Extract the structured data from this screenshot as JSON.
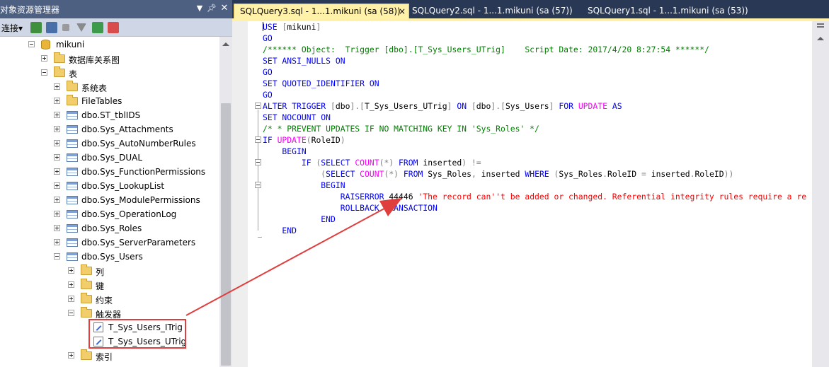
{
  "object_explorer": {
    "title": "对象资源管理器",
    "pin_icon": "pin-icon",
    "close_icon": "close-icon",
    "toolbar": {
      "connect_label": "连接",
      "connect_caret": "▾"
    },
    "tree": [
      {
        "label": "mikuni",
        "icon": "database-icon",
        "expander": "minus"
      },
      {
        "label": "数据库关系图",
        "icon": "folder-icon",
        "expander": "plus"
      },
      {
        "label": "表",
        "icon": "folder-icon",
        "expander": "minus"
      },
      {
        "label": "系统表",
        "icon": "folder-icon",
        "expander": "plus"
      },
      {
        "label": "FileTables",
        "icon": "folder-icon",
        "expander": "plus"
      },
      {
        "label": "dbo.ST_tblIDS",
        "icon": "table-icon",
        "expander": "plus"
      },
      {
        "label": "dbo.Sys_Attachments",
        "icon": "table-icon",
        "expander": "plus"
      },
      {
        "label": "dbo.Sys_AutoNumberRules",
        "icon": "table-icon",
        "expander": "plus"
      },
      {
        "label": "dbo.Sys_DUAL",
        "icon": "table-icon",
        "expander": "plus"
      },
      {
        "label": "dbo.Sys_FunctionPermissions",
        "icon": "table-icon",
        "expander": "plus"
      },
      {
        "label": "dbo.Sys_LookupList",
        "icon": "table-icon",
        "expander": "plus"
      },
      {
        "label": "dbo.Sys_ModulePermissions",
        "icon": "table-icon",
        "expander": "plus"
      },
      {
        "label": "dbo.Sys_OperationLog",
        "icon": "table-icon",
        "expander": "plus"
      },
      {
        "label": "dbo.Sys_Roles",
        "icon": "table-icon",
        "expander": "plus"
      },
      {
        "label": "dbo.Sys_ServerParameters",
        "icon": "table-icon",
        "expander": "plus"
      },
      {
        "label": "dbo.Sys_Users",
        "icon": "table-icon",
        "expander": "minus"
      },
      {
        "label": "列",
        "icon": "folder-icon",
        "expander": "plus"
      },
      {
        "label": "键",
        "icon": "folder-icon",
        "expander": "plus"
      },
      {
        "label": "约束",
        "icon": "folder-icon",
        "expander": "plus"
      },
      {
        "label": "触发器",
        "icon": "folder-icon",
        "expander": "minus"
      },
      {
        "label": "T_Sys_Users_ITrig",
        "icon": "trigger-icon",
        "expander": "none"
      },
      {
        "label": "T_Sys_Users_UTrig",
        "icon": "trigger-icon",
        "expander": "none"
      },
      {
        "label": "索引",
        "icon": "folder-icon",
        "expander": "plus"
      }
    ]
  },
  "tabs": [
    {
      "label": "SQLQuery3.sql - 1...1.mikuni (sa (58))",
      "active": true,
      "close": "×"
    },
    {
      "label": "SQLQuery2.sql - 1...1.mikuni (sa (57))",
      "active": false
    },
    {
      "label": "SQLQuery1.sql - 1...1.mikuni (sa (53))",
      "active": false
    }
  ],
  "code_lines": [
    [
      [
        "kw",
        "USE "
      ],
      [
        "gr",
        "["
      ],
      [
        "tx",
        "mikuni"
      ],
      [
        "gr",
        "]"
      ]
    ],
    [
      [
        "kw",
        "GO"
      ]
    ],
    [
      [
        "cm",
        "/****** Object:  Trigger [dbo].[T_Sys_Users_UTrig]    Script Date: 2017/4/20 8:27:54 ******/"
      ]
    ],
    [
      [
        "kw",
        "SET ANSI_NULLS ON"
      ]
    ],
    [
      [
        "kw",
        "GO"
      ]
    ],
    [
      [
        "kw",
        "SET QUOTED_IDENTIFIER ON"
      ]
    ],
    [
      [
        "kw",
        "GO"
      ]
    ],
    [
      [
        "kw",
        "ALTER TRIGGER "
      ],
      [
        "gr",
        "["
      ],
      [
        "tx",
        "dbo"
      ],
      [
        "gr",
        "].["
      ],
      [
        "tx",
        "T_Sys_Users_UTrig"
      ],
      [
        "gr",
        "]"
      ],
      [
        "kw",
        " ON "
      ],
      [
        "gr",
        "["
      ],
      [
        "tx",
        "dbo"
      ],
      [
        "gr",
        "].["
      ],
      [
        "tx",
        "Sys_Users"
      ],
      [
        "gr",
        "]"
      ],
      [
        "kw",
        " FOR "
      ],
      [
        "fn",
        "UPDATE"
      ],
      [
        "kw",
        " AS"
      ]
    ],
    [
      [
        "kw",
        "SET NOCOUNT ON"
      ]
    ],
    [
      [
        "cm",
        "/* * PREVENT UPDATES IF NO MATCHING KEY IN 'Sys_Roles' */"
      ]
    ],
    [
      [
        "kw",
        "IF "
      ],
      [
        "fn",
        "UPDATE"
      ],
      [
        "gr",
        "("
      ],
      [
        "tx",
        "RoleID"
      ],
      [
        "gr",
        ")"
      ]
    ],
    [
      [
        "kw",
        "    BEGIN"
      ]
    ],
    [
      [
        "kw",
        "        IF "
      ],
      [
        "gr",
        "("
      ],
      [
        "kw",
        "SELECT "
      ],
      [
        "fn",
        "COUNT"
      ],
      [
        "gr",
        "(*)"
      ],
      [
        "kw",
        " FROM "
      ],
      [
        "tx",
        "inserted"
      ],
      [
        "gr",
        ") !="
      ]
    ],
    [
      [
        "tx",
        "            "
      ],
      [
        "gr",
        "("
      ],
      [
        "kw",
        "SELECT "
      ],
      [
        "fn",
        "COUNT"
      ],
      [
        "gr",
        "(*)"
      ],
      [
        "kw",
        " FROM "
      ],
      [
        "tx",
        "Sys_Roles"
      ],
      [
        "gr",
        ","
      ],
      [
        "tx",
        " inserted "
      ],
      [
        "kw",
        "WHERE "
      ],
      [
        "gr",
        "("
      ],
      [
        "tx",
        "Sys_Roles"
      ],
      [
        "gr",
        "."
      ],
      [
        "tx",
        "RoleID "
      ],
      [
        "gr",
        "="
      ],
      [
        "tx",
        " inserted"
      ],
      [
        "gr",
        "."
      ],
      [
        "tx",
        "RoleID"
      ],
      [
        "gr",
        "))"
      ]
    ],
    [
      [
        "kw",
        "            BEGIN"
      ]
    ],
    [
      [
        "kw",
        "                RAISERROR "
      ],
      [
        "tx",
        "44446 "
      ],
      [
        "st",
        "'The record can''t be added or changed. Referential integrity rules require a re"
      ]
    ],
    [
      [
        "kw",
        "                ROLLBACK TRANSACTION"
      ]
    ],
    [
      [
        "kw",
        "            END"
      ]
    ],
    [
      [
        "kw",
        "    END"
      ]
    ]
  ]
}
